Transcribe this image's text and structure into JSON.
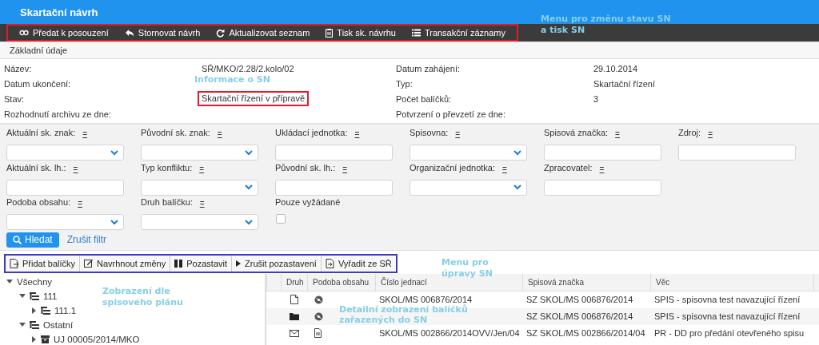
{
  "header": {
    "title": "Skartační návrh"
  },
  "actions": [
    {
      "label": "Předat k posouzení",
      "kind": "link"
    },
    {
      "label": "Stornovat návrh",
      "kind": "reply"
    },
    {
      "label": "Aktualizovat seznam",
      "kind": "refresh"
    },
    {
      "label": "Tisk sk. návrhu",
      "kind": "print"
    },
    {
      "label": "Transakční záznamy",
      "kind": "list"
    }
  ],
  "section_title": "Základní údaje",
  "info": {
    "left": [
      {
        "label": "Název:",
        "value": "SŘ/MKO/2.28/2.kolo/02"
      },
      {
        "label": "Datum ukončení:"
      },
      {
        "label": "Stav:",
        "value": "Skartační řízení v přípravě"
      },
      {
        "label": "Rozhodnutí archivu ze dne:"
      }
    ],
    "right": [
      {
        "label": "Datum zahájení:",
        "value": "29.10.2014"
      },
      {
        "label": "Typ:",
        "value": "Skartační řízení"
      },
      {
        "label": "Počet balíčků:",
        "value": "3"
      },
      {
        "label": "Potvrzení o převzetí ze dne:"
      }
    ]
  },
  "filters": [
    {
      "label": "Aktuální sk. znak:",
      "operator": "=",
      "kind": "select"
    },
    {
      "label": "Původní sk. znak:",
      "operator": "=",
      "kind": "select"
    },
    {
      "label": "Ukládací jednotka:",
      "operator": "=",
      "kind": "text"
    },
    {
      "label": "Spisovna:",
      "operator": "=",
      "kind": "select"
    },
    {
      "label": "Spisová značka:",
      "operator": "=",
      "kind": "text"
    },
    {
      "label": "Zdroj:",
      "operator": "=",
      "kind": "text"
    },
    {
      "label": "Aktuální sk. lh.:",
      "operator": "=",
      "kind": "text"
    },
    {
      "label": "Typ konfliktu:",
      "operator": "=",
      "kind": "select"
    },
    {
      "label": "Původní sk. lh.:",
      "operator": "=",
      "kind": "text"
    },
    {
      "label": "Organizační jednotka:",
      "operator": "=",
      "kind": "select"
    },
    {
      "label": "Zpracovatel:",
      "operator": "=",
      "kind": "text"
    },
    {
      "kind": "empty"
    },
    {
      "label": "Podoba obsahu:",
      "operator": "=",
      "kind": "select"
    },
    {
      "label": "Druh balíčku:",
      "operator": "=",
      "kind": "select"
    },
    {
      "label": "Pouze vyžádané",
      "kind": "checkbox",
      "checked": false
    }
  ],
  "search_button": "Hledat",
  "clear_filter_link": "Zrušit filtr",
  "edit_actions": [
    {
      "label": "Přidat balíčky",
      "kind": "add"
    },
    {
      "label": "Navrhnout změny",
      "kind": "edit"
    },
    {
      "label": "Pozastavit",
      "kind": "pause"
    },
    {
      "label": "Zrušit pozastavení",
      "kind": "play"
    },
    {
      "label": "Vyřadit ze SŘ",
      "kind": "remove"
    }
  ],
  "tree": [
    {
      "label": "Všechny",
      "expanded": true,
      "children": [
        {
          "label": "111",
          "expanded": true,
          "kind": "group",
          "children": [
            {
              "label": "111.1",
              "expanded": false,
              "kind": "group"
            }
          ]
        },
        {
          "label": "Ostatní",
          "expanded": true,
          "kind": "group",
          "children": [
            {
              "label": "UJ 00005/2014/MKO",
              "expanded": false,
              "kind": "unit"
            }
          ]
        }
      ]
    }
  ],
  "table": {
    "columns": [
      "Druh",
      "Podoba obsahu",
      "Číslo jednací",
      "Spisová značka",
      "Věc"
    ],
    "rows": [
      {
        "druh": {
          "kind": "file"
        },
        "podoba": {
          "kind": "disc"
        },
        "cislo": "SKOL/MS 006876/2014",
        "znacka": "SZ SKOL/MS 006876/2014",
        "vec": "SPIS - spisovna test navazující řízení"
      },
      {
        "druh": {
          "kind": "folder"
        },
        "podoba": {
          "kind": "disc"
        },
        "znacka": "SZ SKOL/MS 006876/2014",
        "vec": "SPIS - spisovna test navazující řízení"
      },
      {
        "druh": {
          "kind": "envelope"
        },
        "podoba": {
          "kind": "document"
        },
        "cislo": "SKOL/MS 002866/2014OVV/Jen/04",
        "znacka": "SZ SKOL/MS 002866/2014/04",
        "vec": "PR - DD pro předání otevřeného spisu"
      }
    ]
  },
  "annotations": [
    {
      "text": "Menu pro změnu stavu SN a tisk SN",
      "kind": "top-menu"
    },
    {
      "text": "Informace o SN",
      "kind": "info"
    },
    {
      "text": "Menu pro úpravy SN",
      "kind": "edit-menu"
    },
    {
      "text": "Zobrazení dle spisového plánu",
      "kind": "tree"
    },
    {
      "text": "Detailní zobrazení balíčků zařazených do SN",
      "kind": "table"
    }
  ]
}
